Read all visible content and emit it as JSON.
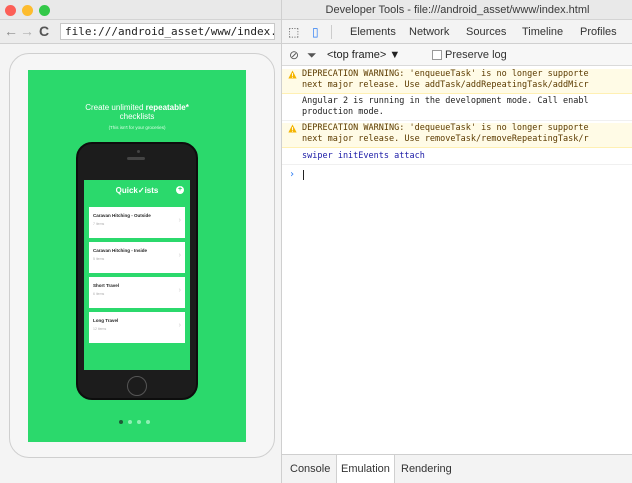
{
  "browser": {
    "url": "file:///android_asset/www/index.html"
  },
  "app_preview": {
    "promo_prefix": "Create unlimited ",
    "promo_bold": "repeatable*",
    "promo_line2": "checklists",
    "promo_note": "(This isn't for your groceries)",
    "app_title": "Quick✓ists",
    "lists": [
      {
        "title": "Caravan Hitching - Outside",
        "sub": "7 items"
      },
      {
        "title": "Caravan Hitching - Inside",
        "sub": "5 items"
      },
      {
        "title": "Short Travel",
        "sub": "6 items"
      },
      {
        "title": "Long Travel",
        "sub": "12 items"
      }
    ],
    "pager": {
      "count": 4,
      "active": 0
    }
  },
  "devtools": {
    "title": "Developer Tools - file:///android_asset/www/index.html",
    "tabs": [
      "Elements",
      "Network",
      "Sources",
      "Timeline",
      "Profiles"
    ],
    "frame_select": "<top frame> ▼",
    "preserve_log": "Preserve log",
    "messages": [
      {
        "type": "warn",
        "lines": [
          "DEPRECATION WARNING: 'enqueueTask' is no longer supporte",
          "next major release. Use addTask/addRepeatingTask/addMicr"
        ]
      },
      {
        "type": "log",
        "lines": [
          "Angular 2 is running in the development mode. Call enabl",
          "production mode."
        ]
      },
      {
        "type": "warn",
        "lines": [
          "DEPRECATION WARNING: 'dequeueTask' is no longer supporte",
          "next major release. Use removeTask/removeRepeatingTask/r"
        ]
      },
      {
        "type": "info",
        "lines": [
          "swiper initEvents attach"
        ]
      }
    ],
    "drawer_tabs": [
      "Console",
      "Emulation",
      "Rendering"
    ],
    "drawer_active": 1
  },
  "colors": {
    "app_green": "#2bd96c",
    "warn_bg": "#fffbe6",
    "accent_blue": "#2d7ef5"
  }
}
